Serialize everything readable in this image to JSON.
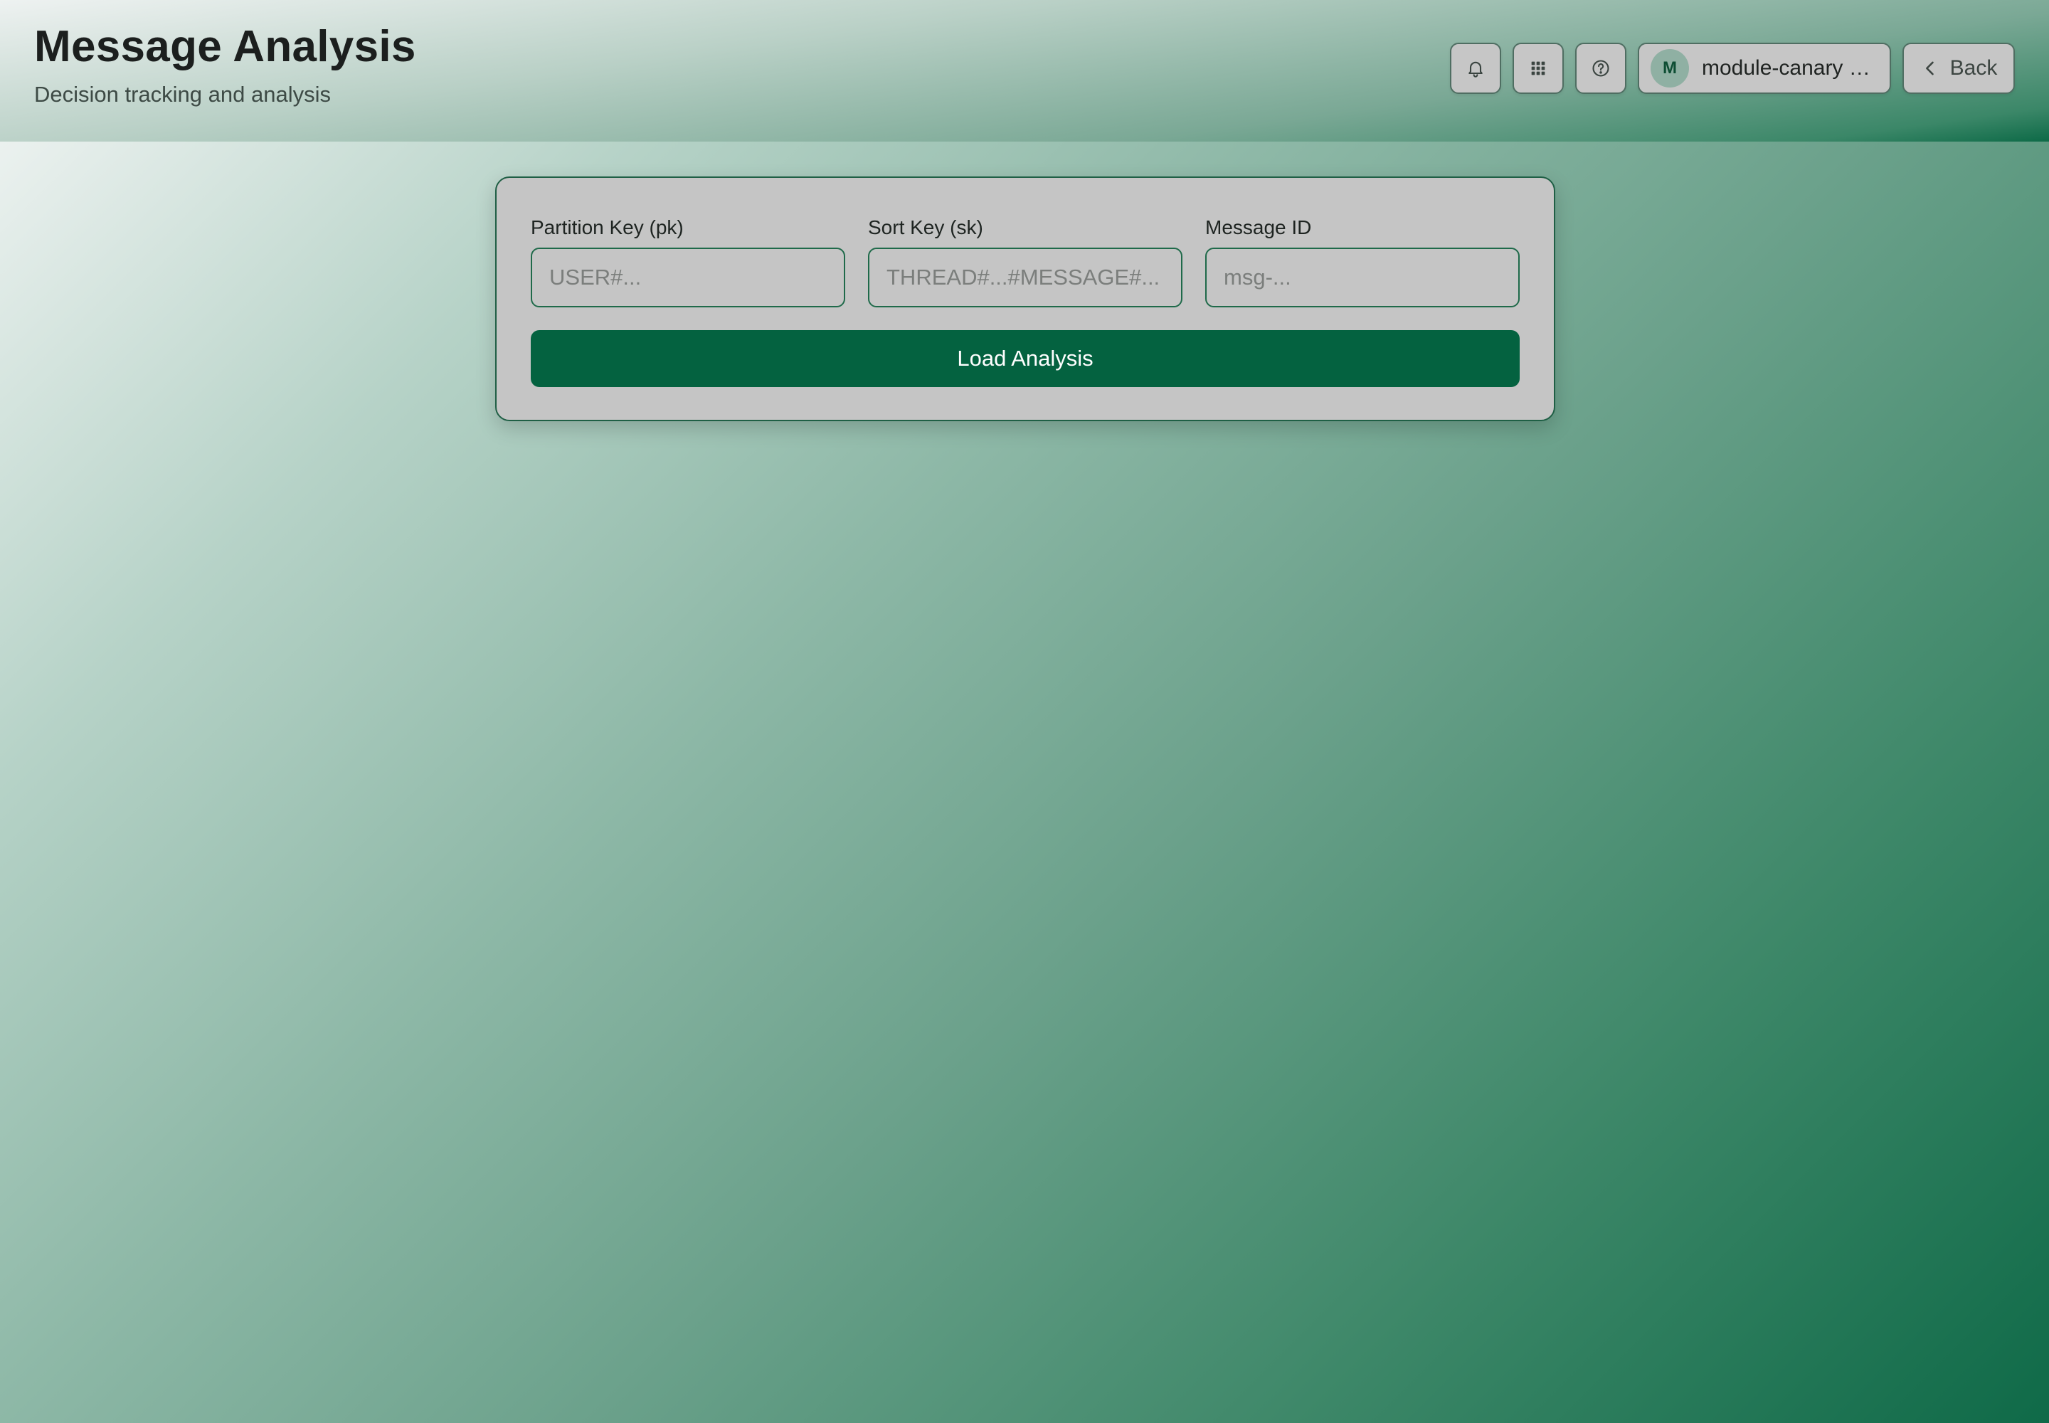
{
  "header": {
    "title": "Message Analysis",
    "subtitle": "Decision tracking and analysis",
    "icons": [
      "bell-icon",
      "grid-icon",
      "help-icon",
      "chevron-left-icon"
    ],
    "user": {
      "initial": "M",
      "name": "module-canary S…"
    },
    "back_label": "Back"
  },
  "form": {
    "fields": [
      {
        "label": "Partition Key (pk)",
        "placeholder": "USER#...",
        "value": ""
      },
      {
        "label": "Sort Key (sk)",
        "placeholder": "THREAD#...#MESSAGE#...",
        "value": ""
      },
      {
        "label": "Message ID",
        "placeholder": "msg-...",
        "value": ""
      }
    ],
    "submit_label": "Load Analysis"
  },
  "colors": {
    "primary": "#046240",
    "card_background": "#c5c5c5",
    "border": "#1f6a4a"
  }
}
